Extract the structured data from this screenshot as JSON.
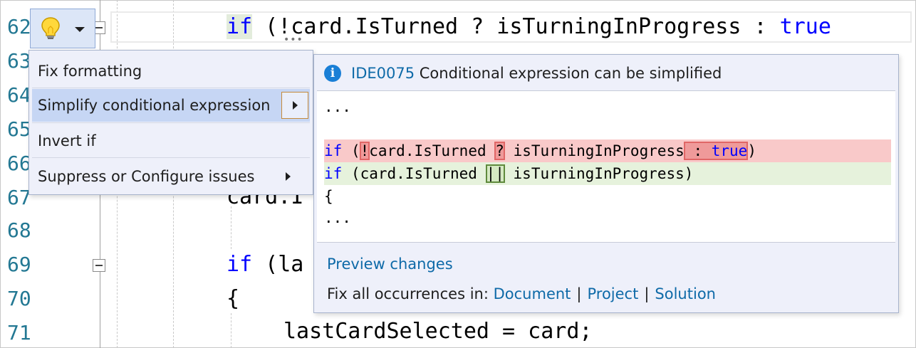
{
  "editor": {
    "line_numbers": [
      "62",
      "63",
      "64",
      "65",
      "66",
      "67",
      "68",
      "69",
      "70",
      "71"
    ],
    "line62": {
      "kw": "if",
      "text": " (!card.IsTurned ? isTurningInProgress : ",
      "kw2": "true"
    },
    "line67_text": "card.I",
    "line69": {
      "kw": "if",
      "text": " (la"
    },
    "line70_text": "{",
    "line71_text": "lastCardSelected = card;",
    "ellipsis": "•••"
  },
  "lightbulb": {
    "icon": "lightbulb-icon",
    "dropdown_icon": "chevron-down-icon"
  },
  "menu": {
    "items": [
      {
        "label": "Fix formatting"
      },
      {
        "label": "Simplify conditional expression"
      },
      {
        "label": "Invert if"
      },
      {
        "label": "Suppress or Configure issues"
      }
    ]
  },
  "preview_panel": {
    "info_icon": "info-icon",
    "diagnostic_id": "IDE0075",
    "title": "Conditional expression can be simplified",
    "code": {
      "ellipsis_top": "...",
      "removed": {
        "kw": "if",
        "p1": " (",
        "h1": "!",
        "p2": "card.IsTurned ",
        "h2": "?",
        "p3": " isTurningInProgress",
        "h3a": " : ",
        "h3b": "true",
        "p4": ")"
      },
      "added": {
        "kw": "if",
        "p1": " (card.IsTurned ",
        "h1": "||",
        "p2": " isTurningInProgress)"
      },
      "brace": "{",
      "ellipsis_bottom": "..."
    },
    "preview_link": "Preview changes",
    "fix_all_label": "Fix all occurrences in:",
    "scopes": [
      "Document",
      "Project",
      "Solution"
    ],
    "separator": "|"
  },
  "colors": {
    "removed_bg": "#f9c9c9",
    "added_bg": "#e6f2dc",
    "link": "#0e6aa8",
    "keyword": "#0000ff",
    "line_number": "#237893"
  }
}
